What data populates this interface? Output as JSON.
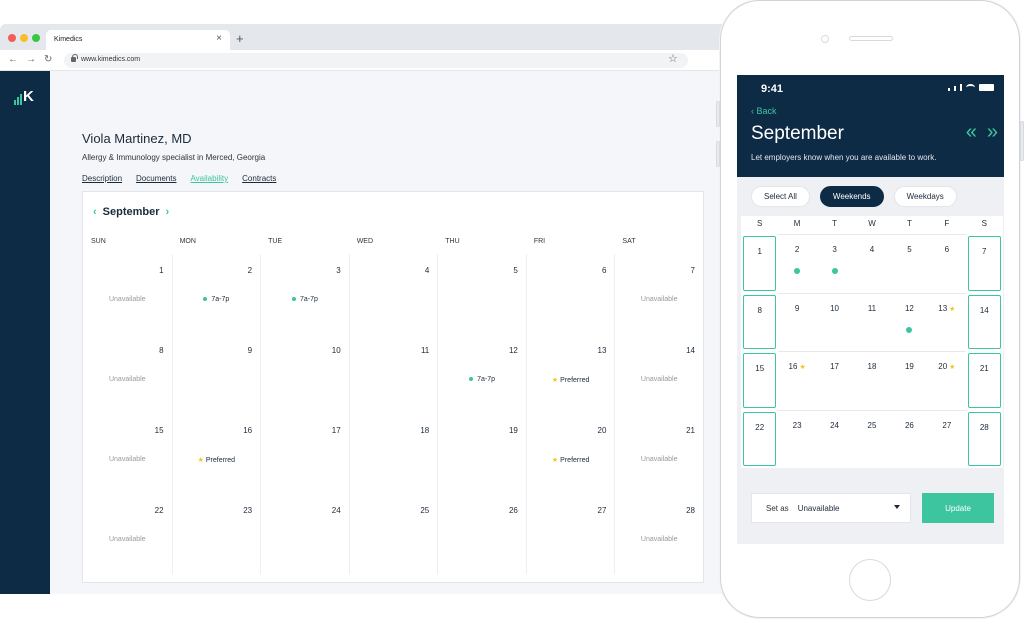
{
  "browser": {
    "tab_title": "Kimedics",
    "tab_close": "×",
    "new_tab": "+",
    "url": "www.kimedics.com",
    "star": "☆",
    "nav": {
      "back": "←",
      "forward": "→",
      "reload": "↻"
    }
  },
  "brand": {
    "logo_letter": "K",
    "accent": "#3dc5a0",
    "navy": "#0e2b45"
  },
  "profile": {
    "name": "Viola Martinez, MD",
    "subtitle": "Allergy & Immunology specialist in Merced, Georgia",
    "tabs": [
      "Description",
      "Documents",
      "Availability",
      "Contracts"
    ],
    "active_tab": "Availability"
  },
  "calendar": {
    "month": "September",
    "prev": "‹",
    "next": "›",
    "days_of_week": [
      "SUN",
      "MON",
      "TUE",
      "WED",
      "THU",
      "FRI",
      "SAT"
    ],
    "weeks": [
      [
        {
          "day": "1",
          "note": "Unavailable",
          "kind": "unav"
        },
        {
          "day": "2",
          "note": "7a-7p",
          "kind": "time"
        },
        {
          "day": "3",
          "note": "7a-7p",
          "kind": "time"
        },
        {
          "day": "4",
          "note": "",
          "kind": ""
        },
        {
          "day": "5",
          "note": "",
          "kind": ""
        },
        {
          "day": "6",
          "note": "",
          "kind": ""
        },
        {
          "day": "7",
          "note": "Unavailable",
          "kind": "unav"
        }
      ],
      [
        {
          "day": "8",
          "note": "Unavailable",
          "kind": "unav"
        },
        {
          "day": "9",
          "note": "",
          "kind": ""
        },
        {
          "day": "10",
          "note": "",
          "kind": ""
        },
        {
          "day": "11",
          "note": "",
          "kind": ""
        },
        {
          "day": "12",
          "note": "7a-7p",
          "kind": "time"
        },
        {
          "day": "13",
          "note": "Preferred",
          "kind": "pref"
        },
        {
          "day": "14",
          "note": "Unavailable",
          "kind": "unav"
        }
      ],
      [
        {
          "day": "15",
          "note": "Unavailable",
          "kind": "unav"
        },
        {
          "day": "16",
          "note": "Preferred",
          "kind": "pref"
        },
        {
          "day": "17",
          "note": "",
          "kind": ""
        },
        {
          "day": "18",
          "note": "",
          "kind": ""
        },
        {
          "day": "19",
          "note": "",
          "kind": ""
        },
        {
          "day": "20",
          "note": "Preferred",
          "kind": "pref"
        },
        {
          "day": "21",
          "note": "Unavailable",
          "kind": "unav"
        }
      ],
      [
        {
          "day": "22",
          "note": "Unavailable",
          "kind": "unav"
        },
        {
          "day": "23",
          "note": "",
          "kind": ""
        },
        {
          "day": "24",
          "note": "",
          "kind": ""
        },
        {
          "day": "25",
          "note": "",
          "kind": ""
        },
        {
          "day": "26",
          "note": "",
          "kind": ""
        },
        {
          "day": "27",
          "note": "",
          "kind": ""
        },
        {
          "day": "28",
          "note": "Unavailable",
          "kind": "unav"
        }
      ]
    ]
  },
  "phone": {
    "time": "9:41",
    "back": "Back",
    "month": "September",
    "prev": "«",
    "next": "»",
    "subtitle": "Let employers know when you are available to work.",
    "filters": [
      "Select All",
      "Weekends",
      "Weekdays"
    ],
    "active_filter": "Weekends",
    "days_of_week": [
      "S",
      "M",
      "T",
      "W",
      "T",
      "F",
      "S"
    ],
    "weeks": [
      [
        {
          "day": "1",
          "sel": true
        },
        {
          "day": "2",
          "dot": true
        },
        {
          "day": "3",
          "dot": true
        },
        {
          "day": "4"
        },
        {
          "day": "5"
        },
        {
          "day": "6"
        },
        {
          "day": "7",
          "sel": true
        }
      ],
      [
        {
          "day": "8",
          "sel": true
        },
        {
          "day": "9"
        },
        {
          "day": "10"
        },
        {
          "day": "11"
        },
        {
          "day": "12",
          "dot": true
        },
        {
          "day": "13",
          "star": true
        },
        {
          "day": "14",
          "sel": true
        }
      ],
      [
        {
          "day": "15",
          "sel": true
        },
        {
          "day": "16",
          "star": true
        },
        {
          "day": "17"
        },
        {
          "day": "18"
        },
        {
          "day": "19"
        },
        {
          "day": "20",
          "star": true
        },
        {
          "day": "21",
          "sel": true
        }
      ],
      [
        {
          "day": "22",
          "sel": true
        },
        {
          "day": "23"
        },
        {
          "day": "24"
        },
        {
          "day": "25"
        },
        {
          "day": "26"
        },
        {
          "day": "27"
        },
        {
          "day": "28",
          "sel": true
        }
      ]
    ],
    "set_as_label": "Set as",
    "set_as_value": "Unavailable",
    "update_label": "Update"
  }
}
